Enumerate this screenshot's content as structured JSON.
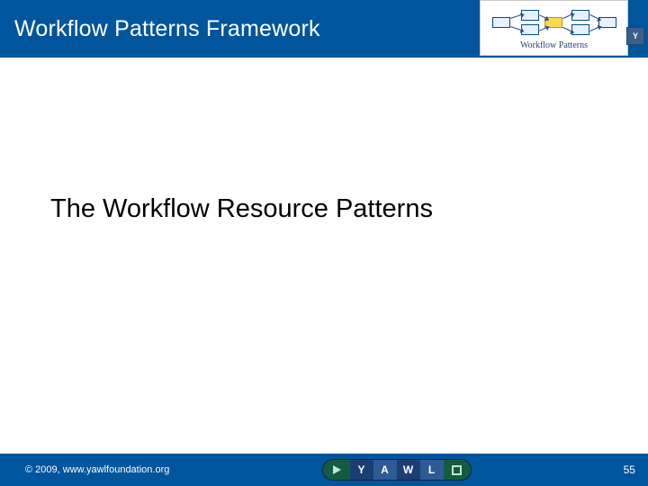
{
  "header": {
    "title": "Workflow Patterns Framework",
    "logo_caption": "Workflow Patterns",
    "badge_letter": "Y"
  },
  "main": {
    "title": "The Workflow Resource Patterns"
  },
  "footer": {
    "copyright": "© 2009, www.yawlfoundation.org",
    "page_number": "55",
    "logo_letters": {
      "y": "Y",
      "a": "A",
      "w": "W",
      "l": "L"
    }
  }
}
